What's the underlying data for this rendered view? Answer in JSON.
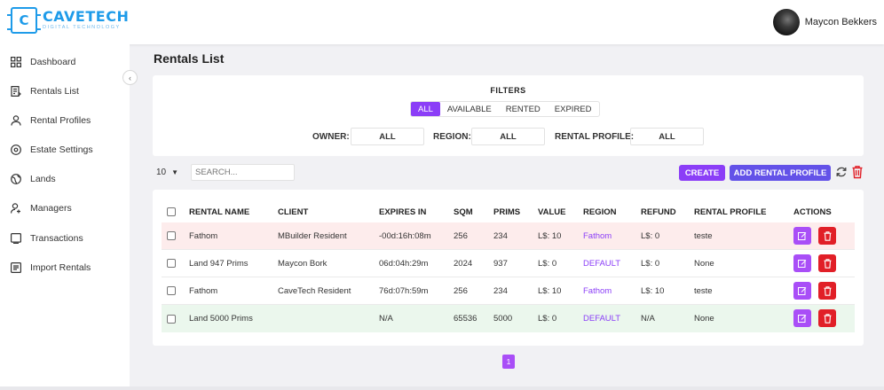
{
  "brand": {
    "logo_letter": "C",
    "name": "CAVETECH",
    "tagline": "DIGITAL TECHNOLOGY"
  },
  "user": {
    "name": "Maycon Bekkers"
  },
  "sidebar": {
    "items": [
      {
        "label": "Dashboard",
        "icon": "grid-icon"
      },
      {
        "label": "Rentals List",
        "icon": "list-icon"
      },
      {
        "label": "Rental Profiles",
        "icon": "user-icon"
      },
      {
        "label": "Estate Settings",
        "icon": "location-icon"
      },
      {
        "label": "Lands",
        "icon": "globe-icon"
      },
      {
        "label": "Managers",
        "icon": "user-plus-icon"
      },
      {
        "label": "Transactions",
        "icon": "receipt-icon"
      },
      {
        "label": "Import Rentals",
        "icon": "import-icon"
      }
    ],
    "collapse_glyph": "‹"
  },
  "main": {
    "title": "Rentals List"
  },
  "filters": {
    "title": "FILTERS",
    "status_tabs": [
      {
        "label": "ALL",
        "active": true
      },
      {
        "label": "AVAILABLE",
        "active": false
      },
      {
        "label": "RENTED",
        "active": false
      },
      {
        "label": "EXPIRED",
        "active": false
      }
    ],
    "owner": {
      "label": "OWNER:",
      "value": "ALL"
    },
    "region": {
      "label": "REGION:",
      "value": "ALL"
    },
    "rental_profile": {
      "label": "RENTAL PROFILE:",
      "value": "ALL"
    }
  },
  "toolbar": {
    "page_size": "10",
    "search_placeholder": "SEARCH...",
    "create_label": "CREATE",
    "add_profile_label": "ADD RENTAL PROFILE"
  },
  "table": {
    "columns": [
      "RENTAL NAME",
      "CLIENT",
      "EXPIRES IN",
      "SQM",
      "PRIMS",
      "VALUE",
      "REGION",
      "REFUND",
      "RENTAL PROFILE",
      "ACTIONS"
    ],
    "rows": [
      {
        "name": "Fathom",
        "client": "MBuilder Resident",
        "expires": "-00d:16h:08m",
        "sqm": "256",
        "prims": "234",
        "value": "L$: 10",
        "region": "Fathom",
        "refund": "L$: 0",
        "profile": "teste",
        "status_color": "#fdecec"
      },
      {
        "name": "Land 947 Prims",
        "client": "Maycon Bork",
        "expires": "06d:04h:29m",
        "sqm": "2024",
        "prims": "937",
        "value": "L$: 0",
        "region": "DEFAULT",
        "refund": "L$: 0",
        "profile": "None",
        "status_color": "#ffffff"
      },
      {
        "name": "Fathom",
        "client": "CaveTech Resident",
        "expires": "76d:07h:59m",
        "sqm": "256",
        "prims": "234",
        "value": "L$: 10",
        "region": "Fathom",
        "refund": "L$: 10",
        "profile": "teste",
        "status_color": "#ffffff"
      },
      {
        "name": "Land 5000 Prims",
        "client": "",
        "expires": "N/A",
        "sqm": "65536",
        "prims": "5000",
        "value": "L$: 0",
        "region": "DEFAULT",
        "refund": "N/A",
        "profile": "None",
        "status_color": "#ebf7ed"
      }
    ]
  },
  "pagination": {
    "current": "1"
  },
  "colors": {
    "accent": "#8b3ef7",
    "secondary": "#6352e8",
    "danger": "#e11f27",
    "brand": "#1e9be9"
  }
}
